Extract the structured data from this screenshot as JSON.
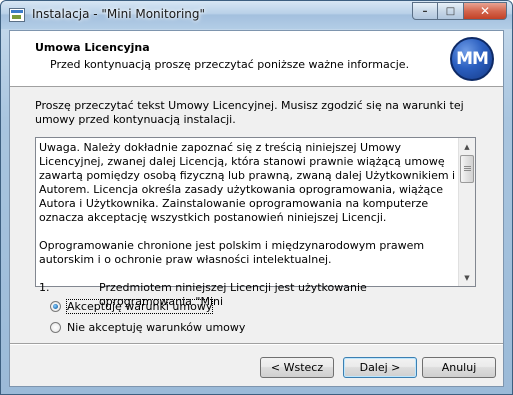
{
  "window": {
    "title": "Instalacja - \"Mini Monitoring\""
  },
  "caption_buttons": {
    "minimize_glyph": "–",
    "maximize_glyph": "□",
    "close_glyph": "✕"
  },
  "header": {
    "title": "Umowa Licencyjna",
    "subtitle": "Przed kontynuacją proszę przeczytać poniższe ważne informacje.",
    "logo_text": "MM"
  },
  "intro_text": "Proszę przeczytać tekst Umowy Licencyjnej. Musisz zgodzić się na warunki tej umowy przed kontynuacją instalacji.",
  "license": {
    "paragraph_1": "Uwaga. Należy dokładnie zapoznać się z treścią niniejszej Umowy Licencyjnej, zwanej dalej Licencją, która stanowi prawnie wiążącą umowę zawartą pomiędzy osobą fizyczną lub prawną, zwaną dalej Użytkownikiem i Autorem. Licencja określa zasady użytkowania oprogramowania, wiążące Autora i Użytkownika. Zainstalowanie oprogramowania na komputerze oznacza akceptację wszystkich postanowień niniejszej Licencji.",
    "paragraph_2": "Oprogramowanie chronione jest polskim i międzynarodowym prawem autorskim i o ochronie praw własności intelektualnej.",
    "item_1_number": "1.",
    "item_1_text": "Przedmiotem niniejszej Licencji jest użytkowanie oprogramowania \"Mini"
  },
  "scrollbar": {
    "up_glyph": "▲",
    "down_glyph": "▼"
  },
  "options": {
    "accept_label": "Akceptuję warunki umowy",
    "decline_label": "Nie akceptuję warunków umowy",
    "selected": "accept"
  },
  "buttons": {
    "back_label": "< Wstecz",
    "next_label": "Dalej >",
    "cancel_label": "Anuluj"
  }
}
